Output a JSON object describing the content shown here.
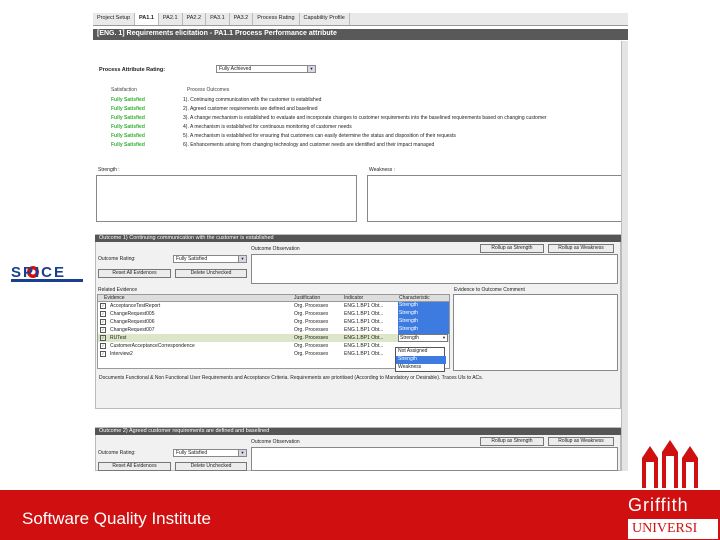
{
  "tabs": [
    "Project Setup",
    "PA1.1",
    "PA2.1",
    "PA2.2",
    "PA3.1",
    "PA3.2",
    "Process Rating",
    "Capability Profile"
  ],
  "page_title": "[ENG. 1] Requirements elicitation - PA1.1 Process Performance attribute",
  "rating": {
    "label": "Process Attribute Rating:",
    "value": "Fully Achieved"
  },
  "outcomes_header": {
    "satisfaction": "Satisfaction",
    "outcomes": "Process Outcomes"
  },
  "outcomes": [
    {
      "status": "Fully Satisfied",
      "text": "1). Continuing communication with the customer is established"
    },
    {
      "status": "Fully Satisfied",
      "text": "2). Agreed customer requirements are defined and baselined"
    },
    {
      "status": "Fully Satisfied",
      "text": "3). A change mechanism is established to evaluate and incorporate changes to customer requirements into the baselined requirements based on changing customer"
    },
    {
      "status": "Fully Satisfied",
      "text": "4). A mechanism is established for continuous monitoring of customer needs"
    },
    {
      "status": "Fully Satisfied",
      "text": "5). A mechanism is established for ensuring that customers can easily determine the status and disposition of their requests"
    },
    {
      "status": "Fully Satisfied",
      "text": "6). Enhancements arising from changing technology and customer needs are identified and their impact managed"
    }
  ],
  "strength_label": "Strength :",
  "weakness_label": "Weakness :",
  "outcome1": {
    "title": "Outcome 1) Continuing communication with the customer is established",
    "observation": "Outcome Observation",
    "rollup_strength": "Rollup as Strength",
    "rollup_weakness": "Rollup as Weakness",
    "rating_label": "Outcome Rating:",
    "rating_value": "Fully Satisfied",
    "reset": "Reset All Evidences",
    "delete": "Delete Unchecked",
    "related_evidence": "Related Evidence",
    "evidence_comment": "Evidence to Outcome Comment",
    "columns": [
      "Evidence",
      "Justification",
      "Indicator",
      "Characteristic"
    ],
    "rows": [
      {
        "evidence": "AcceptanceTestReport",
        "justification": "Org. Processes",
        "indicator": "ENG.1.BP1 Obt...",
        "char": "Strength"
      },
      {
        "evidence": "ChangeRequest005",
        "justification": "Org. Processes",
        "indicator": "ENG.1.BP1 Obt...",
        "char": "Strength"
      },
      {
        "evidence": "ChangeRequest006",
        "justification": "Org. Processes",
        "indicator": "ENG.1.BP1 Obt...",
        "char": "Strength"
      },
      {
        "evidence": "ChangeRequest007",
        "justification": "Org. Processes",
        "indicator": "ENG.1.BP1 Obt...",
        "char": "Strength"
      },
      {
        "evidence": "RUTest",
        "justification": "Org. Processes",
        "indicator": "ENG.1.BP1 Obt...",
        "char": "Strength"
      },
      {
        "evidence": "CustomerAcceptanceCorrespondence",
        "justification": "Org. Processes",
        "indicator": "ENG.1.BP1 Obt...",
        "char": ""
      },
      {
        "evidence": "Interview2",
        "justification": "Org. Processes",
        "indicator": "ENG.1.BP1 Obt...",
        "char": ""
      }
    ],
    "dropdown_options": [
      "Not Assigned",
      "Strength",
      "Weakness"
    ],
    "comment": "Documents Functional & Non Functional User Requirements and Acceptance Criteria. Requirements are prioritised (According to Mandatory or Desirable). Traces UIs to ACs."
  },
  "outcome2": {
    "title": "Outcome 2) Agreed customer requirements are defined and baselined",
    "observation": "Outcome Observation",
    "rollup_strength": "Rollup as Strength",
    "rollup_weakness": "Rollup as Weakness",
    "rating_label": "Outcome Rating:",
    "rating_value": "Fully Satisfied",
    "reset": "Reset All Evidences",
    "delete": "Delete Unchecked"
  },
  "spice_logo": "SPICE",
  "footer_title": "Software Quality Institute",
  "griffith": "Griffith",
  "university": "UNIVERSI",
  "colors": {
    "footer_red": "#d01010",
    "header_gray": "#595959",
    "satisfied_green": "#2fb12f",
    "selection_blue": "#3d7be0"
  }
}
